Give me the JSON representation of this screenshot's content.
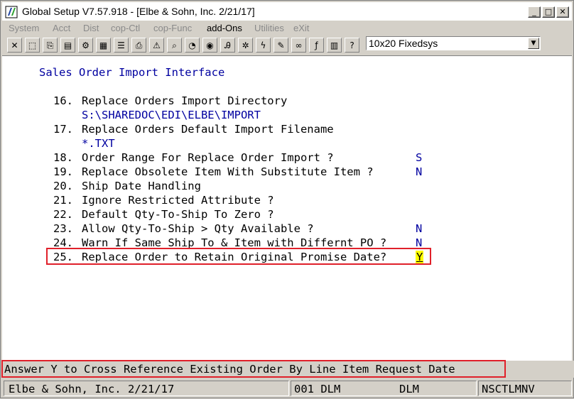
{
  "window": {
    "title": "Global Setup V7.57.918 - [Elbe & Sohn, Inc. 2/21/17]",
    "minimize_glyph": "_",
    "maximize_glyph": "□",
    "close_glyph": "✕"
  },
  "menu": [
    {
      "label": "System",
      "active": false
    },
    {
      "label": "Acct",
      "active": false
    },
    {
      "label": "Dist",
      "active": false
    },
    {
      "label": "cop-Ctl",
      "active": false
    },
    {
      "label": "cop-Func",
      "active": false
    },
    {
      "label": "add-Ons",
      "active": true
    },
    {
      "label": "Utilities",
      "active": false
    },
    {
      "label": "eXit",
      "active": false
    }
  ],
  "toolbar": {
    "icons": [
      "close-x-icon",
      "select-icon",
      "copy-icon",
      "paste-icon",
      "gear-icon",
      "document-icon",
      "list-icon",
      "print-icon",
      "alert-icon",
      "search-icon",
      "globe-icon",
      "font-icon",
      "settings-icon",
      "lightning-icon",
      "edit-icon",
      "link-icon",
      "function-icon",
      "notes-icon",
      "help-icon"
    ],
    "font_select": "10x20 Fixedsys"
  },
  "screen": {
    "heading": "Sales Order Import Interface",
    "items": [
      {
        "num": "16.",
        "label": "Replace Orders Import Directory",
        "value": ""
      },
      {
        "num": "",
        "label": "S:\\SHAREDOC\\EDI\\ELBE\\IMPORT",
        "value": "",
        "is_value_line": true
      },
      {
        "num": "17.",
        "label": "Replace Orders Default Import Filename",
        "value": ""
      },
      {
        "num": "",
        "label": "*.TXT",
        "value": "",
        "is_value_line": true
      },
      {
        "num": "18.",
        "label": "Order Range For Replace Order Import ?",
        "value": "S"
      },
      {
        "num": "19.",
        "label": "Replace Obsolete Item With Substitute Item ?",
        "value": "N"
      },
      {
        "num": "20.",
        "label": "Ship Date Handling",
        "value": ""
      },
      {
        "num": "21.",
        "label": "Ignore Restricted Attribute ?",
        "value": ""
      },
      {
        "num": "22.",
        "label": "Default Qty-To-Ship To Zero ?",
        "value": ""
      },
      {
        "num": "23.",
        "label": "Allow Qty-To-Ship > Qty Available ?",
        "value": "N"
      },
      {
        "num": "24.",
        "label": "Warn If Same Ship To & Item with Differnt PO ?",
        "value": "N"
      },
      {
        "num": "25.",
        "label": "Replace Order to Retain Original Promise Date?",
        "value": "Y"
      }
    ]
  },
  "help_line": "Answer Y to Cross Reference Existing Order By Line Item Request Date",
  "status": {
    "company": "Elbe & Sohn, Inc. 2/21/17",
    "code": "001 DLM",
    "user": "DLM",
    "program": "NSCTLMNV"
  },
  "colors": {
    "terminal_text": "#000000",
    "heading_blue": "#0000a0",
    "highlight_red": "#e0202a",
    "cursor_yellow": "#ffff00"
  }
}
